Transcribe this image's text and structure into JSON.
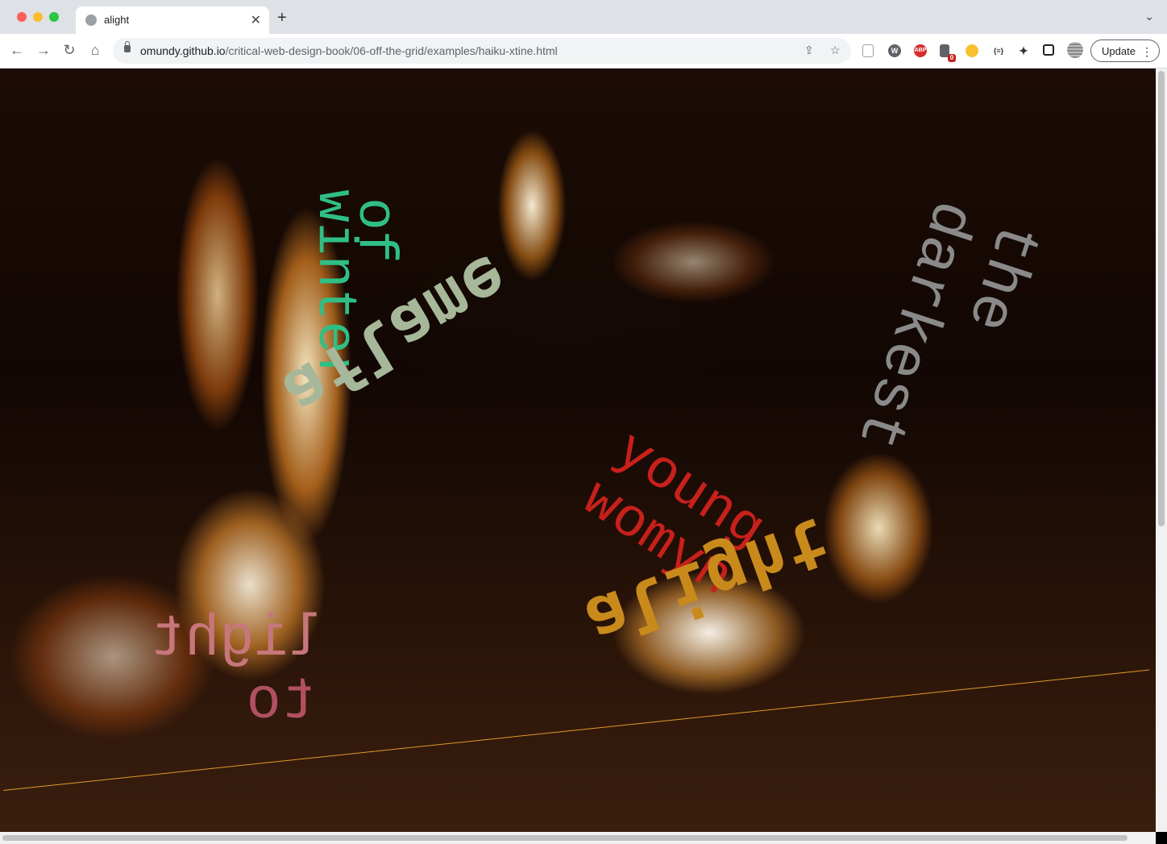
{
  "tab": {
    "title": "alight"
  },
  "address_bar": {
    "host": "omundy.github.io",
    "path": "/critical-web-design-book/06-off-the-grid/examples/haiku-xtine.html"
  },
  "toolbar": {
    "update_label": "Update"
  },
  "extensions": {
    "abp_label": "ABP",
    "badge_count": "0",
    "bracket_label": "{≡}"
  },
  "haiku": {
    "of": "of",
    "winter": "winter",
    "the": "the",
    "darkest": "darkest",
    "young": "young",
    "womyn": "womyn",
    "light": "light",
    "to": "to",
    "fire_green": "aflame",
    "fire_orange": "alight"
  },
  "colors": {
    "green": "#2fbf86",
    "grey": "#8a8a8a",
    "red": "#c8201b",
    "rose": "#c7767c",
    "sage": "#a6b79a",
    "amber": "#c98a1c"
  }
}
